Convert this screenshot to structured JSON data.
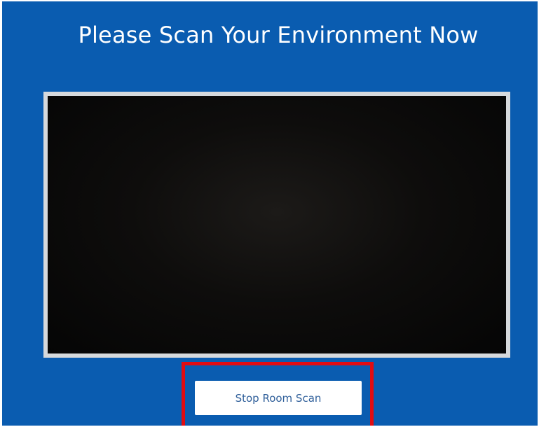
{
  "header": {
    "title": "Please Scan Your Environment Now"
  },
  "scan": {
    "stop_button_label": "Stop Room Scan"
  },
  "colors": {
    "background": "#0a5cb0",
    "frame_border": "#d6d9dc",
    "video_fill": "#050505",
    "highlight": "#e10c12",
    "button_text": "#2f5f9a"
  }
}
